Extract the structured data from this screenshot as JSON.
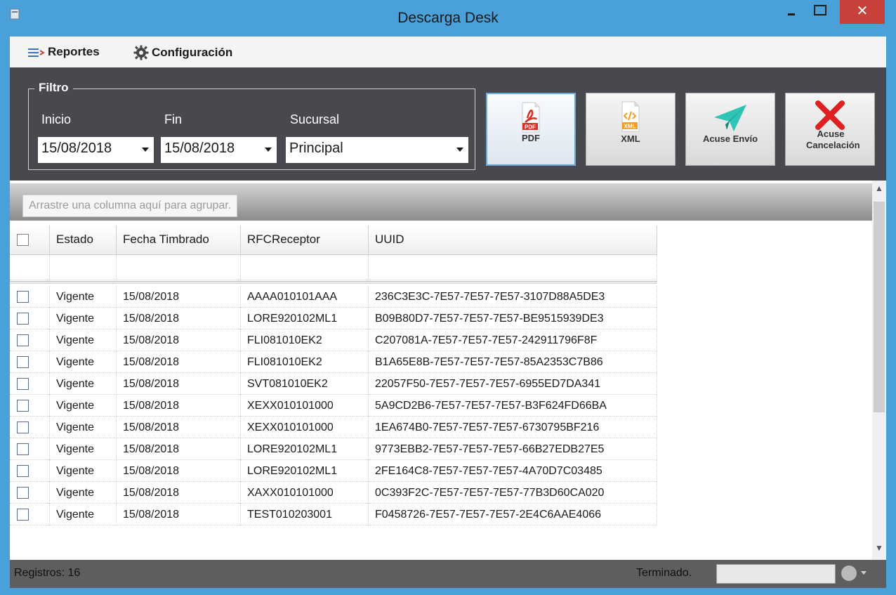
{
  "window": {
    "title": "Descarga Desk",
    "close_glyph": "✕"
  },
  "menu": {
    "items": [
      {
        "label": "Reportes",
        "icon": "list-arrow-icon"
      },
      {
        "label": "Configuración",
        "icon": "gear-icon"
      }
    ]
  },
  "filter": {
    "legend": "Filtro",
    "start_label": "Inicio",
    "end_label": "Fin",
    "branch_label": "Sucursal",
    "start_value": "15/08/2018",
    "end_value": "15/08/2018",
    "branch_value": "Principal"
  },
  "actions": [
    {
      "label": "PDF",
      "icon": "pdf-icon",
      "badge": "PDF"
    },
    {
      "label": "XML",
      "icon": "xml-icon",
      "badge": "XML"
    },
    {
      "label": "Acuse Envío",
      "icon": "paper-plane-icon"
    },
    {
      "label": "Acuse Cancelación",
      "icon": "red-x-icon"
    }
  ],
  "grid": {
    "group_hint": "Arrastre una columna aquí para agrupar.",
    "columns": [
      "Estado",
      "Fecha Timbrado",
      "RFCReceptor",
      "UUID"
    ],
    "rows": [
      [
        "Vigente",
        "15/08/2018",
        "AAAA010101AAA",
        "236C3E3C-7E57-7E57-7E57-3107D88A5DE3"
      ],
      [
        "Vigente",
        "15/08/2018",
        "LORE920102ML1",
        "B09B80D7-7E57-7E57-7E57-BE9515939DE3"
      ],
      [
        "Vigente",
        "15/08/2018",
        "FLI081010EK2",
        "C207081A-7E57-7E57-7E57-242911796F8F"
      ],
      [
        "Vigente",
        "15/08/2018",
        "FLI081010EK2",
        "B1A65E8B-7E57-7E57-7E57-85A2353C7B86"
      ],
      [
        "Vigente",
        "15/08/2018",
        "SVT081010EK2",
        "22057F50-7E57-7E57-7E57-6955ED7DA341"
      ],
      [
        "Vigente",
        "15/08/2018",
        "XEXX010101000",
        "5A9CD2B6-7E57-7E57-7E57-B3F624FD66BA"
      ],
      [
        "Vigente",
        "15/08/2018",
        "XEXX010101000",
        "1EA674B0-7E57-7E57-7E57-6730795BF216"
      ],
      [
        "Vigente",
        "15/08/2018",
        "LORE920102ML1",
        "9773EBB2-7E57-7E57-7E57-66B27EDB27E5"
      ],
      [
        "Vigente",
        "15/08/2018",
        "LORE920102ML1",
        "2FE164C8-7E57-7E57-7E57-4A70D7C03485"
      ],
      [
        "Vigente",
        "15/08/2018",
        "XAXX010101000",
        "0C393F2C-7E57-7E57-7E57-77B3D60CA020"
      ],
      [
        "Vigente",
        "15/08/2018",
        "TEST010203001",
        "F0458726-7E57-7E57-7E57-2E4C6AAE4066"
      ]
    ]
  },
  "status": {
    "records": "Registros: 16",
    "state": "Terminado."
  },
  "colors": {
    "title_bar": "#4aa0d8",
    "toolbar": "#48484f",
    "close": "#c8403a",
    "statusbar": "#5e5e5e"
  }
}
